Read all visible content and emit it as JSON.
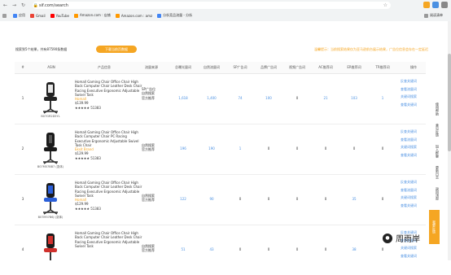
{
  "browser": {
    "url": "sif.com/search",
    "bookmarks": [
      {
        "label": "",
        "color": "#9e9e9e"
      },
      {
        "label": "应用",
        "color": "#4285f4"
      },
      {
        "label": "Gmail",
        "color": "#ea4335"
      },
      {
        "label": "YouTube",
        "color": "#ff0000"
      },
      {
        "label": "Amazon.com : 店铺",
        "color": "#ff9900"
      },
      {
        "label": "Amazon.com : amz",
        "color": "#ff9900"
      },
      {
        "label": "分析竞品流量 - 分析",
        "color": "#4285f4"
      }
    ],
    "reading_list": "阅读清单"
  },
  "summary": {
    "text": "搜索到5个结果，共有87590条数据",
    "export_button": "下载当前页数据",
    "notice": "温馨提示：当前搜索结果仅为亚马逊前台展示结果，广告位信息会存在一定延迟"
  },
  "table": {
    "headers": [
      "#",
      "ASIN",
      "产品信息",
      "流量来源",
      "总曝光量词",
      "自然流量词",
      "SP广告词",
      "品牌广告词",
      "视频广告词",
      "AC推荐词",
      "ER推荐词",
      "TR推荐词",
      "操作"
    ],
    "rows": [
      {
        "index": "1",
        "asin": "B07GR2D5YL",
        "title": "Homall Gaming Chair Office Chair High Back Computer Chair Leather Desk Chair Racing Executive Ergonomic Adjustable Swivel Task",
        "brand": "Homall",
        "price": "$139.99",
        "rating": "★★★★★ 51383",
        "tags": [
          "SP广告位",
          "自然搜索",
          "官方推荐"
        ],
        "values": [
          "1,618",
          "1,400",
          "74",
          "100",
          "0",
          "21",
          "103",
          "1"
        ],
        "ops": [
          "反查关键词",
          "查看流量词",
          "关键词搜索",
          "查看关键词"
        ]
      },
      {
        "index": "2",
        "asin": "B07M57BB7 (变体)",
        "title": "Homall Gaming Chair Office Chair High Back Computer Chair PC Racing Executive Ergonomic Adjustable Swivel Task Chair",
        "brand": "Eksit Brand",
        "price": "$129.99",
        "rating": "★★★★★ 51383",
        "tags": [
          "自然搜索",
          "官方推荐"
        ],
        "values": [
          "196",
          "190",
          "1",
          "0",
          "0",
          "0",
          "0",
          "0"
        ],
        "ops": [
          "反查关键词",
          "查看流量词",
          "关键词搜索",
          "查看关键词"
        ]
      },
      {
        "index": "3",
        "asin": "B07M57B6J (变体)",
        "title": "Homall Gaming Chair Office Chair High Back Computer Chair Leather Desk Chair Racing Executive Ergonomic Adjustable Swivel Task",
        "brand": "Homall",
        "price": "$129.99",
        "rating": "★★★★★ 51383",
        "tags": [
          "自然搜索",
          "官方推荐"
        ],
        "values": [
          "122",
          "90",
          "0",
          "0",
          "0",
          "0",
          "35",
          "0"
        ],
        "ops": [
          "反查关键词",
          "查看流量词",
          "关键词搜索",
          "查看关键词"
        ]
      },
      {
        "index": "4",
        "asin": "",
        "title": "Homall Gaming Chair Office Chair High Back Computer Chair Leather Desk Chair Racing Executive Ergonomic Adjustable Swivel Task",
        "brand": "",
        "price": "",
        "rating": "",
        "tags": [
          "自然搜索",
          "官方推荐"
        ],
        "values": [
          "51",
          "43",
          "0",
          "0",
          "0",
          "0",
          "38",
          "0"
        ],
        "ops": [
          "反查关键词",
          "查看流量词",
          "关键词搜索",
          "查看关键词"
        ]
      }
    ]
  },
  "side_panel": {
    "items": [
      "使用帮助",
      "意见反馈",
      "加入群聊",
      "更新日志",
      "返回顶部"
    ],
    "highlight": "我要反馈"
  },
  "watermark": "周雨岸",
  "colors": {
    "accent": "#f5a623",
    "link": "#4a90e2"
  }
}
